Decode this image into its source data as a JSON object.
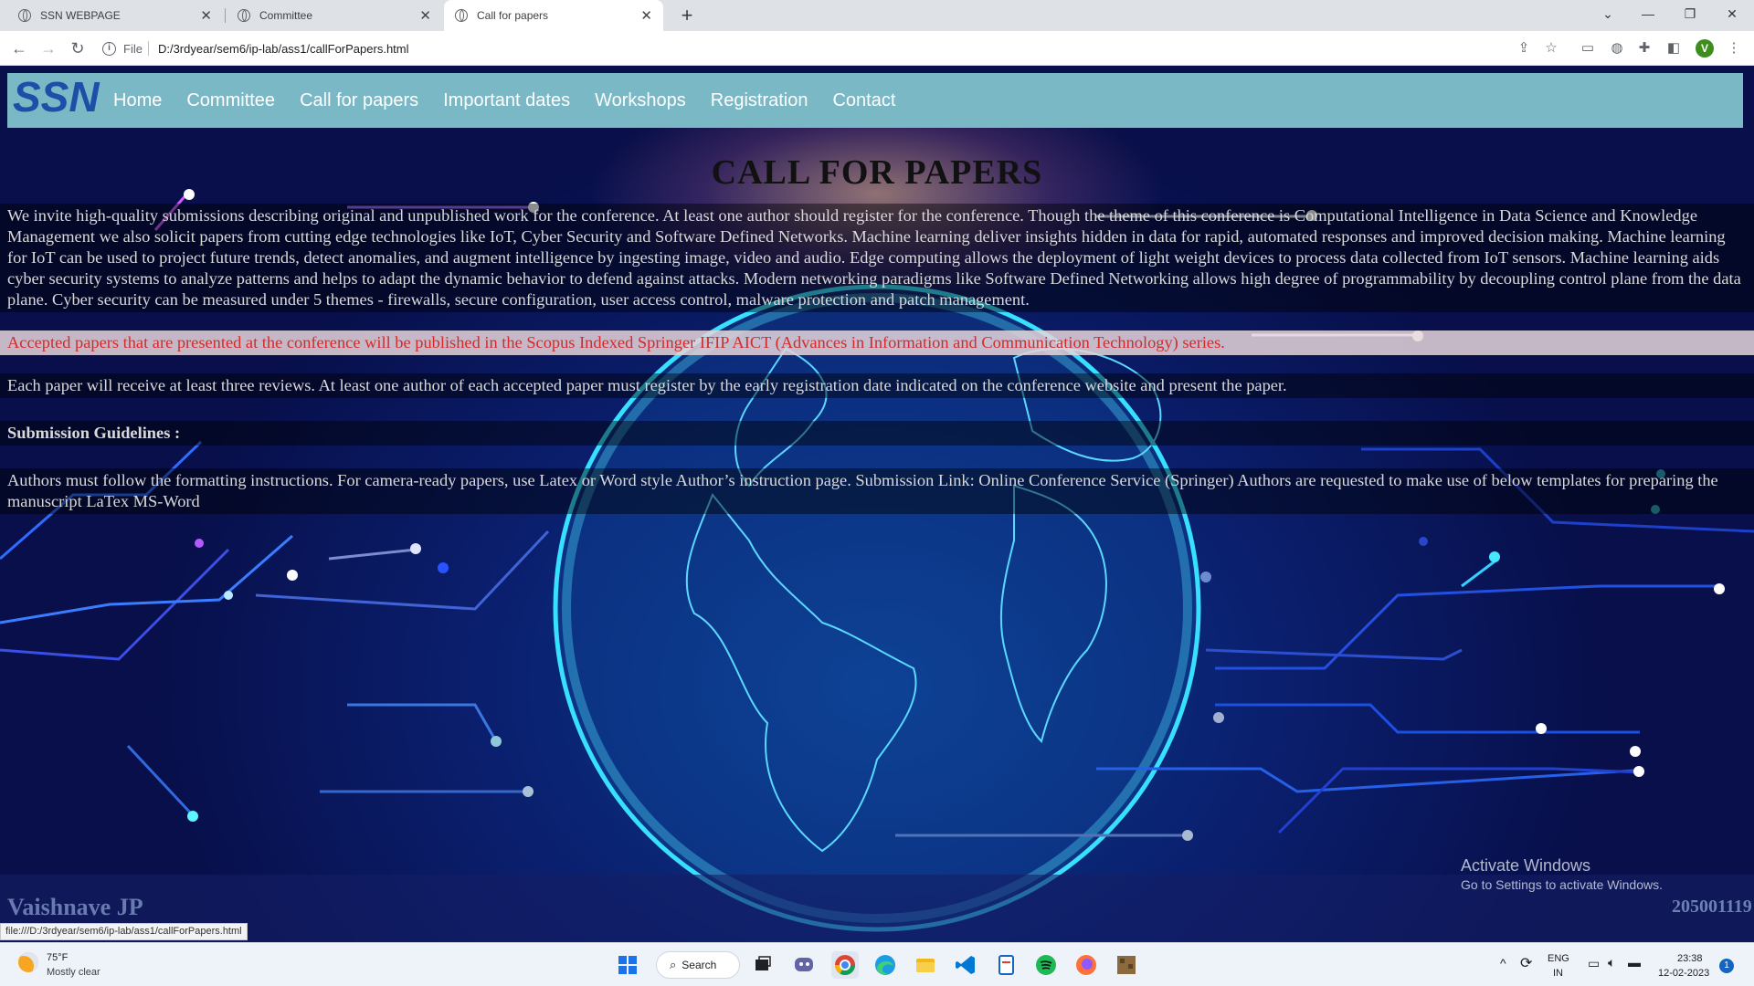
{
  "browser": {
    "tabs": [
      {
        "title": "SSN WEBPAGE",
        "active": false
      },
      {
        "title": "Committee",
        "active": false
      },
      {
        "title": "Call for papers",
        "active": true
      }
    ],
    "new_tab_icon": "plus-icon",
    "address": {
      "scheme": "File",
      "path": "D:/3rdyear/sem6/ip-lab/ass1/callForPapers.html"
    },
    "profile_initial": "V",
    "status_url": "file:///D:/3rdyear/sem6/ip-lab/ass1/callForPapers.html"
  },
  "page": {
    "logo_text": "SSN",
    "nav": [
      "Home",
      "Committee",
      "Call for papers",
      "Important dates",
      "Workshops",
      "Registration",
      "Contact"
    ],
    "title": "CALL FOR PAPERS",
    "paragraphs": {
      "intro": "We invite high-quality submissions describing original and unpublished work for the conference. At least one author should register for the conference. Though the theme of this conference is Computational Intelligence in Data Science and Knowledge Management we also solicit papers from cutting edge technologies like IoT, Cyber Security and Software Defined Networks. Machine learning deliver insights hidden in data for rapid, automated responses and improved decision making. Machine learning for IoT can be used to project future trends, detect anomalies, and augment intelligence by ingesting image, video and audio. Edge computing allows the deployment of light weight devices to process data collected from IoT sensors. Machine learning aids cyber security systems to analyze patterns and helps to adapt the dynamic behavior to defend against attacks. Modern networking paradigms like Software Defined Networking allows high degree of programmability by decoupling control plane from the data plane. Cyber security can be measured under 5 themes - firewalls, secure configuration, user access control, malware protection and patch management.",
      "accepted": "Accepted papers that are presented at the conference will be published in the Scopus Indexed Springer IFIP AICT (Advances in Information and Communication Technology) series.",
      "reviews": "Each paper will receive at least three reviews. At least one author of each accepted paper must register by the early registration date indicated on the conference website and present the paper.",
      "guidelines_heading": "Submission Guidelines :",
      "authors": "Authors must follow the formatting instructions. For camera-ready papers, use Latex or Word style Author’s instruction page. Submission Link: Online Conference Service (Springer) Authors are requested to make use of below templates for preparing the manuscript LaTex MS-Word"
    },
    "footer": {
      "name": "Vaishnave JP",
      "roll": "205001119"
    }
  },
  "watermark": {
    "title": "Activate Windows",
    "subtitle": "Go to Settings to activate Windows."
  },
  "taskbar": {
    "weather": {
      "temp": "75°F",
      "desc": "Mostly clear"
    },
    "search_label": "Search",
    "apps": [
      "windows-start-icon",
      "task-view-icon",
      "teams-chat-icon",
      "chrome-icon",
      "edge-icon",
      "file-explorer-icon",
      "vscode-icon",
      "notepad-icon",
      "spotify-icon",
      "firefox-icon",
      "minecraft-icon"
    ],
    "lang_primary": "ENG",
    "lang_secondary": "IN",
    "time": "23:38",
    "date": "12-02-2023",
    "notifications": "1"
  },
  "colors": {
    "navbar": "#7ab8c6",
    "accepted_text": "#d42a2a",
    "background": "#0a0f4a",
    "circuit": "#3a8cff",
    "globe": "#38e0ff"
  }
}
